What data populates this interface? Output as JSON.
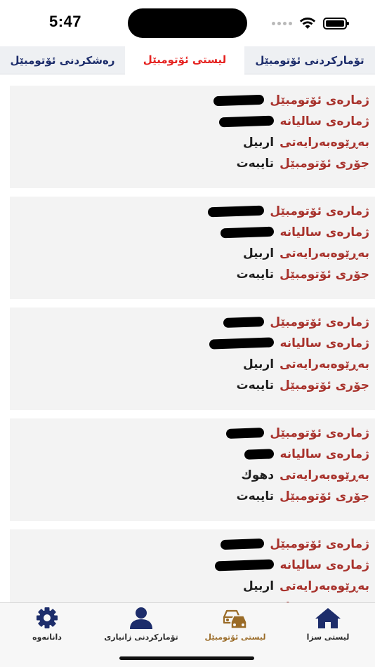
{
  "status": {
    "time": "5:47"
  },
  "tabs": [
    {
      "label": "رەشکردنی ئۆتومبێل"
    },
    {
      "label": "لیستی ئۆتومبێل",
      "active": true
    },
    {
      "label": "تۆمارکردنی ئۆتومبێل"
    }
  ],
  "labels": {
    "car_number": "ژمارەی ئۆتومبێل",
    "annual_number": "ژمارەی سالیانە",
    "directorate": "بەڕێوەبەرایەتی",
    "car_type": "جۆری ئۆتومبێل"
  },
  "vehicles": [
    {
      "car_number": "[redacted]",
      "annual_number": "[redacted]",
      "directorate": "اربيل",
      "car_type": "تایبەت"
    },
    {
      "car_number": "[redacted]",
      "annual_number": "[redacted]",
      "directorate": "اربيل",
      "car_type": "تایبەت"
    },
    {
      "car_number": "[redacted]",
      "annual_number": "[redacted]",
      "directorate": "اربيل",
      "car_type": "تایبەت"
    },
    {
      "car_number": "[redacted]",
      "annual_number": "[redacted]",
      "directorate": "دهوك",
      "car_type": "تایبەت"
    },
    {
      "car_number": "[redacted]",
      "annual_number": "[redacted]",
      "directorate": "اربيل",
      "car_type": ""
    }
  ],
  "bottom_nav": [
    {
      "label": "دانانەوە",
      "icon": "gear-icon"
    },
    {
      "label": "تۆمارکردنی زانیاری",
      "icon": "user-icon"
    },
    {
      "label": "لیستی ئۆتومبێل",
      "icon": "cars-icon",
      "active": true
    },
    {
      "label": "لیستی سزا",
      "icon": "home-icon"
    }
  ],
  "colors": {
    "accent": "#e52220",
    "navy": "#1d2d6b",
    "label_red": "#a8322c",
    "active_nav": "#9a6b27"
  }
}
